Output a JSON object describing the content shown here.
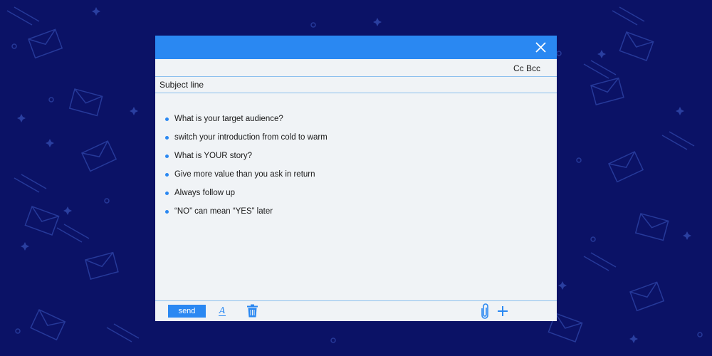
{
  "window": {
    "close_icon": "close-icon",
    "cc_bcc_label": "Cc Bcc",
    "subject": {
      "value": "",
      "placeholder": "Subject line"
    },
    "body": {
      "bullets": [
        "What is your target audience?",
        "switch your introduction from cold to warm",
        "What is YOUR story?",
        "Give more value than you ask in return",
        "Always follow up",
        "“NO” can mean “YES” later"
      ]
    },
    "toolbar": {
      "send_label": "send",
      "format_icon_glyph": "A",
      "icons": [
        "format-text-icon",
        "trash-icon",
        "paperclip-icon",
        "plus-icon"
      ]
    }
  },
  "colors": {
    "background": "#0b1266",
    "accent": "#2a88f2",
    "window_bg": "#f0f3f6",
    "divider": "#8cc0ee"
  }
}
